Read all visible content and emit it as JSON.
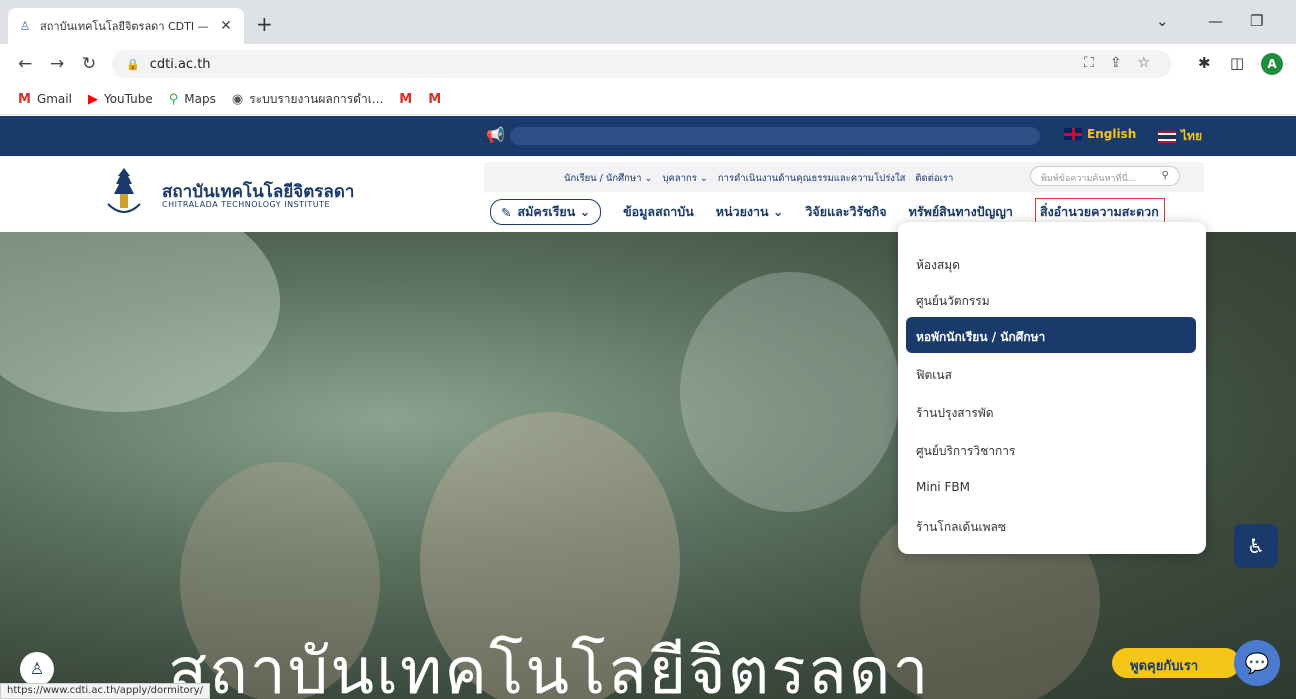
{
  "browser": {
    "tab_title": "สถาบันเทคโนโลยีจิตรลดา CDTI — เพิ่ม",
    "url": "cdti.ac.th",
    "status_url": "https://www.cdti.ac.th/apply/dormitory/",
    "avatar_letter": "A",
    "bookmarks": [
      {
        "label": "Gmail",
        "icon": "gmail-icon"
      },
      {
        "label": "YouTube",
        "icon": "youtube-icon"
      },
      {
        "label": "Maps",
        "icon": "maps-icon"
      },
      {
        "label": "ระบบรายงานผลการดำเ...",
        "icon": "globe-icon"
      }
    ]
  },
  "site": {
    "lang_en": "English",
    "lang_th": "ไทย",
    "logo_th": "สถาบันเทคโนโลยีจิตรลดา",
    "logo_en": "CHITRALADA TECHNOLOGY INSTITUTE",
    "subnav": [
      "นักเรียน / นักศึกษา ⌄",
      "บุคลากร ⌄",
      "การดำเนินงานด้านคุณธรรมและความโปร่งใส",
      "ติดต่อเรา"
    ],
    "search_placeholder": "พิมพ์ข้อความค้นหาที่นี่...",
    "mainnav": {
      "apply": "สมัครเรียน ⌄",
      "about": "ข้อมูลสถาบัน",
      "units": "หน่วยงาน ⌄",
      "research": "วิจัยและวิรัชกิจ",
      "ip": "ทรัพย์สินทางปัญญา",
      "facilities": "สิ่งอำนวยความสะดวก"
    },
    "dropdown": [
      "ห้องสมุด",
      "ศูนย์นวัตกรรม",
      "หอพักนักเรียน / นักศึกษา",
      "ฟิตเนส",
      "ร้านปรุงสารพัด",
      "ศูนย์บริการวิชาการ",
      "Mini FBM",
      "ร้านโกลเด้นเพลซ"
    ],
    "hero_title": "สถาบันเทคโนโลยีจิตรลดา",
    "chat_label": "พูดคุยกับเรา"
  },
  "colors": {
    "brand_navy": "#1a3a6b",
    "accent_yellow": "#f5c518",
    "highlight_red": "#e53935"
  }
}
